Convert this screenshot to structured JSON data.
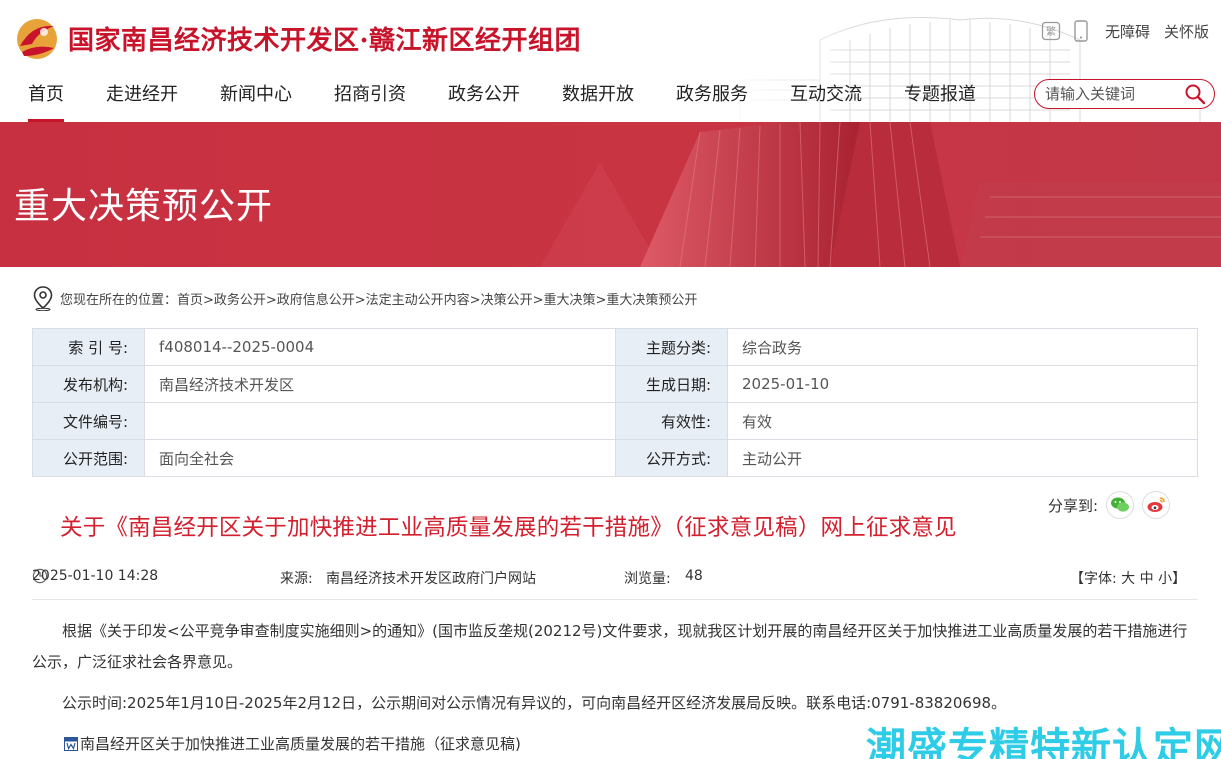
{
  "header": {
    "site_title": "国家南昌经济技术开发区·赣江新区经开组团",
    "tools": {
      "accessibility": "无障碍",
      "elderly": "关怀版",
      "fan_label": "繁"
    }
  },
  "nav": {
    "items": [
      {
        "label": "首页",
        "active": true
      },
      {
        "label": "走进经开"
      },
      {
        "label": "新闻中心"
      },
      {
        "label": "招商引资"
      },
      {
        "label": "政务公开"
      },
      {
        "label": "数据开放"
      },
      {
        "label": "政务服务"
      },
      {
        "label": "互动交流"
      },
      {
        "label": "专题报道"
      }
    ],
    "search_placeholder": "请输入关键词"
  },
  "banner": {
    "title": "重大决策预公开"
  },
  "breadcrumb": {
    "text": "您现在所在的位置：首页>政务公开>政府信息公开>法定主动公开内容>决策公开>重大决策>重大决策预公开"
  },
  "info": {
    "rows": [
      {
        "k1": "索 引 号:",
        "v1": "f408014--2025-0004",
        "k2": "主题分类:",
        "v2": "综合政务"
      },
      {
        "k1": "发布机构:",
        "v1": "南昌经济技术开发区",
        "k2": "生成日期:",
        "v2": "2025-01-10"
      },
      {
        "k1": "文件编号:",
        "v1": "",
        "k2": "有效性:",
        "v2": "有效"
      },
      {
        "k1": "公开范围:",
        "v1": "面向全社会",
        "k2": "公开方式:",
        "v2": "主动公开"
      }
    ]
  },
  "article": {
    "share_label": "分享到:",
    "title": "关于《南昌经开区关于加快推进工业高质量发展的若干措施》（征求意见稿）网上征求意见",
    "date": "2025-01-10 14:28",
    "source_label": "来源:",
    "source": "南昌经济技术开发区政府门户网站",
    "views_label": "浏览量:",
    "views": "48",
    "font_size": "【字体:  大  中  小】",
    "paragraph1": "根据《关于印发<公平竞争审查制度实施细则>的通知》(国市监反垄规(20212号)文件要求，现就我区计划开展的南昌经开区关于加快推进工业高质量发展的若干措施进行公示，广泛征求社会各界意见。",
    "paragraph2": "公示时间:2025年1月10日-2025年2月12日，公示期间对公示情况有异议的，可向南昌经开区经济发展局反映。联系电话:0791-83820698。",
    "attachment": "南昌经开区关于加快推进工业高质量发展的若干措施（征求意见稿)"
  },
  "watermark": "潮盛专精特新认定网",
  "colors": {
    "brand": "#c8142b",
    "banner": "#c8303f",
    "watermark": "#1dc8e4"
  }
}
